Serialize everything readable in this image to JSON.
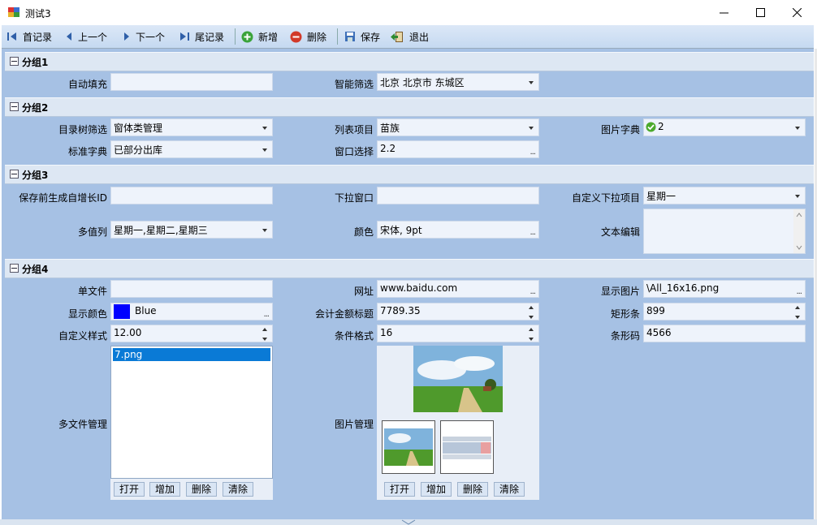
{
  "window": {
    "title": "测试3"
  },
  "toolbar": {
    "first": "首记录",
    "prev": "上一个",
    "next": "下一个",
    "last": "尾记录",
    "add": "新增",
    "delete": "删除",
    "save": "保存",
    "exit": "退出"
  },
  "groups": {
    "g1": "分组1",
    "g2": "分组2",
    "g3": "分组3",
    "g4": "分组4"
  },
  "g1": {
    "autofill_label": "自动填充",
    "autofill_value": "",
    "smart_filter_label": "智能筛选",
    "smart_filter_value": "北京 北京市 东城区"
  },
  "g2": {
    "tree_filter_label": "目录树筛选",
    "tree_filter_value": "窗体类管理",
    "list_item_label": "列表项目",
    "list_item_value": "苗族",
    "pic_dict_label": "图片字典",
    "pic_dict_value": "2",
    "std_dict_label": "标准字典",
    "std_dict_value": "已部分出库",
    "window_select_label": "窗口选择",
    "window_select_value": "2.2"
  },
  "g3": {
    "autoid_label": "保存前生成自增长ID",
    "autoid_value": "",
    "dropdown_window_label": "下拉窗口",
    "dropdown_window_value": "",
    "custom_dropdown_label": "自定义下拉项目",
    "custom_dropdown_value": "星期一",
    "multivalue_label": "多值列",
    "multivalue_value": "星期一,星期二,星期三",
    "color_label": "颜色",
    "color_value": "宋体, 9pt",
    "text_edit_label": "文本编辑",
    "text_edit_value": ""
  },
  "g4": {
    "single_file_label": "单文件",
    "single_file_value": "",
    "url_label": "网址",
    "url_value": "www.baidu.com",
    "show_image_label": "显示图片",
    "show_image_value": "\\All_16x16.png",
    "show_color_label": "显示颜色",
    "show_color_value": "Blue",
    "show_color_swatch": "#0000ff",
    "amount_label": "会计金额标题",
    "amount_value": "7789.35",
    "bar_label": "矩形条",
    "bar_value": "899",
    "custom_style_label": "自定义样式",
    "custom_style_value": "12.00",
    "cond_format_label": "条件格式",
    "cond_format_value": "16",
    "barcode_label": "条形码",
    "barcode_value": "4566",
    "multifile_label": "多文件管理",
    "multifile_items": [
      "7.png"
    ],
    "image_mgr_label": "图片管理"
  },
  "buttons": {
    "open": "打开",
    "add": "增加",
    "delete": "删除",
    "clear": "清除"
  }
}
